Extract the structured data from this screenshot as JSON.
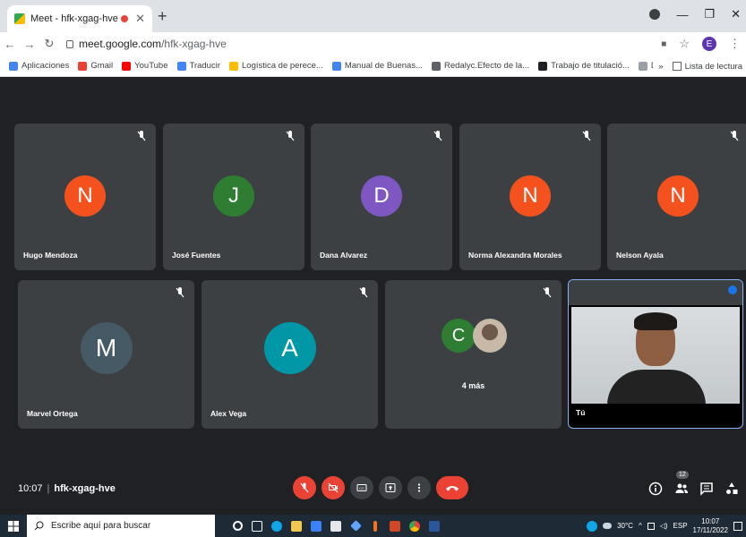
{
  "browser": {
    "tab_title": "Meet - hfk-xgag-hve",
    "url_domain": "meet.google.com",
    "url_path": "/hfk-xgag-hve",
    "profile_initial": "E",
    "bookmarks": [
      {
        "label": "Aplicaciones",
        "color": "#4285f4"
      },
      {
        "label": "Gmail",
        "color": "#ea4335"
      },
      {
        "label": "YouTube",
        "color": "#ff0000"
      },
      {
        "label": "Traducir",
        "color": "#4285f4"
      },
      {
        "label": "Logística de perece...",
        "color": "#fbbc04"
      },
      {
        "label": "Manual de Buenas...",
        "color": "#4285f4"
      },
      {
        "label": "Redalyc.Efecto de la...",
        "color": "#5f6368"
      },
      {
        "label": "Trabajo de titulació...",
        "color": "#202124"
      },
      {
        "label": "Descargas - Protoc...",
        "color": "#9aa0a6"
      }
    ],
    "bookmark_overflow": "»",
    "reading_list": "Lista de lectura"
  },
  "participants": [
    {
      "name": "Hugo Mendoza",
      "initial": "N",
      "color": "#f4511e"
    },
    {
      "name": "José Fuentes",
      "initial": "J",
      "color": "#2e7d32"
    },
    {
      "name": "Dana Alvarez",
      "initial": "D",
      "color": "#7e57c2"
    },
    {
      "name": "Norma Alexandra Morales",
      "initial": "N",
      "color": "#f4511e"
    },
    {
      "name": "Nelson Ayala",
      "initial": "N",
      "color": "#f4511e"
    },
    {
      "name": "Marvel Ortega",
      "initial": "M",
      "color": "#455a64"
    },
    {
      "name": "Alex Vega",
      "initial": "A",
      "color": "#0097a7"
    }
  ],
  "more_tile": {
    "initial": "C",
    "color": "#2e7d32",
    "label": "4 más"
  },
  "self_tile": {
    "label": "Tú"
  },
  "meeting": {
    "time": "10:07",
    "code": "hfk-xgag-hve",
    "participant_count": "12"
  },
  "taskbar": {
    "search_placeholder": "Escribe aquí para buscar",
    "weather": "30°C",
    "language": "ESP",
    "clock_time": "10:07",
    "clock_date": "17/11/2022"
  }
}
